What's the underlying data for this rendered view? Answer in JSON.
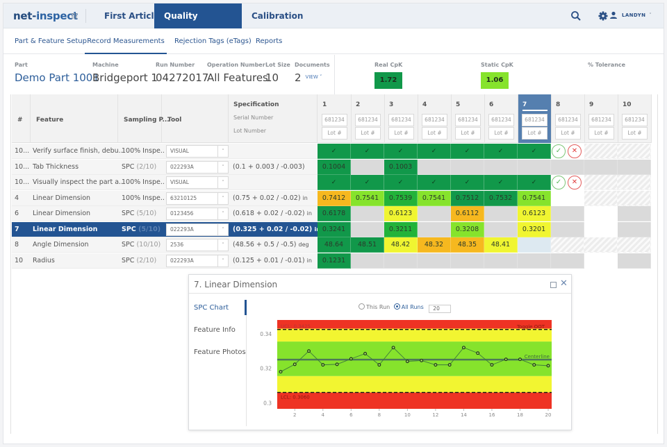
{
  "app": {
    "logo": {
      "part1": "net",
      "part2": "-",
      "part3": "inspect"
    },
    "top_nav": [
      {
        "label": "First Articles",
        "active": false
      },
      {
        "label": "Quality Management",
        "active": true
      },
      {
        "label": "Calibration",
        "active": false
      }
    ],
    "user": "LANDYN",
    "icons": [
      "search-icon",
      "gear-icon",
      "user-icon",
      "chevron-down-icon",
      "grid-icon"
    ]
  },
  "sub_nav": [
    {
      "label": "Part & Feature Setup",
      "active": false
    },
    {
      "label": "Record Measurements",
      "active": true
    },
    {
      "label": "Rejection Tags (eTags)",
      "active": false
    },
    {
      "label": "Reports",
      "active": false
    }
  ],
  "info": {
    "part": {
      "label": "Part",
      "value": "Demo Part 1001"
    },
    "machine": {
      "label": "Machine",
      "value": "Bridgeport 1"
    },
    "run_number": {
      "label": "Run Number",
      "value": "04272017"
    },
    "operation_number": {
      "label": "Operation Number",
      "value": "All Features"
    },
    "lot_size": {
      "label": "Lot Size",
      "value": "10"
    },
    "documents": {
      "label": "Documents",
      "value": "2",
      "link": "VIEW ˅"
    },
    "real_cpk": {
      "label": "Real CpK",
      "value": "1.72",
      "color": "#11984a"
    },
    "static_cpk": {
      "label": "Static CpK",
      "value": "1.06",
      "color": "#86e32c"
    },
    "tolerance": {
      "label": "% Tolerance",
      "value": ""
    }
  },
  "table": {
    "headers": {
      "num": "#",
      "feature": "Feature",
      "sampling": "Sampling P...",
      "tool": "Tool",
      "spec": "Specification",
      "serial": "Serial Number",
      "lot": "Lot Number"
    },
    "columns": [
      {
        "n": "1",
        "serial": "681234",
        "lot": "Lot #"
      },
      {
        "n": "2",
        "serial": "681234",
        "lot": "Lot #"
      },
      {
        "n": "3",
        "serial": "681234",
        "lot": "Lot #"
      },
      {
        "n": "4",
        "serial": "681234",
        "lot": "Lot #"
      },
      {
        "n": "5",
        "serial": "681234",
        "lot": "Lot #"
      },
      {
        "n": "6",
        "serial": "681234",
        "lot": "Lot #"
      },
      {
        "n": "7",
        "serial": "681234",
        "lot": "Lot #",
        "active": true
      },
      {
        "n": "8",
        "serial": "681234",
        "lot": "Lot #"
      },
      {
        "n": "9",
        "serial": "681234",
        "lot": "Lot #"
      },
      {
        "n": "10",
        "serial": "681234",
        "lot": "Lot #"
      }
    ],
    "rows": [
      {
        "num": "10...",
        "feature": "Verify surface finish, debu...",
        "sampling": "100% Inspe...",
        "sampling_sub": "",
        "tool": "VISUAL",
        "spec": "",
        "unit": "",
        "cells": [
          [
            "dg",
            "✓"
          ],
          [
            "dg",
            "✓"
          ],
          [
            "dg",
            "✓"
          ],
          [
            "dg",
            "✓"
          ],
          [
            "dg",
            "✓"
          ],
          [
            "dg",
            "✓"
          ],
          [
            "dg",
            "✓"
          ],
          [
            "passfail",
            ""
          ],
          [
            "hatch",
            ""
          ],
          [
            "hatch",
            ""
          ]
        ]
      },
      {
        "num": "10...",
        "feature": "Tab Thickness",
        "sampling": "SPC",
        "sampling_sub": "(2/10)",
        "tool": "022293A",
        "spec": "(0.1 + 0.003 / -0.003)",
        "unit": "",
        "cells": [
          [
            "dg",
            "0.1004"
          ],
          [
            "gr",
            ""
          ],
          [
            "dg",
            "0.1003"
          ],
          [
            "gr",
            ""
          ],
          [
            "gr",
            ""
          ],
          [
            "gr",
            ""
          ],
          [
            "gr",
            ""
          ],
          [
            "gr",
            ""
          ],
          [
            "gr",
            ""
          ],
          [
            "gr",
            ""
          ]
        ]
      },
      {
        "num": "10...",
        "feature": "Visually inspect the part a...",
        "sampling": "100% Inspe...",
        "sampling_sub": "",
        "tool": "VISUAL",
        "spec": "",
        "unit": "",
        "cells": [
          [
            "dg",
            "✓"
          ],
          [
            "dg",
            "✓"
          ],
          [
            "dg",
            "✓"
          ],
          [
            "dg",
            "✓"
          ],
          [
            "dg",
            "✓"
          ],
          [
            "dg",
            "✓"
          ],
          [
            "dg",
            "✓"
          ],
          [
            "passfail",
            ""
          ],
          [
            "hatch",
            ""
          ],
          [
            "hatch",
            ""
          ]
        ]
      },
      {
        "num": "4",
        "feature": "Linear Dimension",
        "sampling": "100% Inspe...",
        "sampling_sub": "",
        "tool": "63210125",
        "spec": "(0.75 + 0.02 / -0.02)",
        "unit": "in",
        "cells": [
          [
            "or",
            "0.7412"
          ],
          [
            "lg",
            "0.7541"
          ],
          [
            "mg",
            "0.7539"
          ],
          [
            "lg",
            "0.7541"
          ],
          [
            "dg",
            "0.7512"
          ],
          [
            "dg",
            "0.7532"
          ],
          [
            "lg",
            "0.7541"
          ],
          [
            "wh",
            ""
          ],
          [
            "hatch",
            ""
          ],
          [
            "hatch",
            ""
          ]
        ]
      },
      {
        "num": "6",
        "feature": "Linear Dimension",
        "sampling": "SPC",
        "sampling_sub": "(5/10)",
        "tool": "0123456",
        "spec": "(0.618 + 0.02 / -0.02)",
        "unit": "in",
        "cells": [
          [
            "dg",
            "0.6178"
          ],
          [
            "gr",
            ""
          ],
          [
            "yl",
            "0.6123"
          ],
          [
            "gr",
            ""
          ],
          [
            "or",
            "0.6112"
          ],
          [
            "gr",
            ""
          ],
          [
            "yl",
            "0.6123"
          ],
          [
            "gr",
            ""
          ],
          [
            "wh",
            ""
          ],
          [
            "gr",
            ""
          ]
        ]
      },
      {
        "num": "7",
        "feature": "Linear Dimension",
        "sampling": "SPC",
        "sampling_sub": "(5/10)",
        "tool": "022293A",
        "spec": "(0.325 + 0.02 / -0.02)",
        "unit": "in",
        "selected": true,
        "cells": [
          [
            "dg",
            "0.3241"
          ],
          [
            "gr",
            ""
          ],
          [
            "mg",
            "0.3211"
          ],
          [
            "gr",
            ""
          ],
          [
            "lg",
            "0.3208"
          ],
          [
            "gr",
            ""
          ],
          [
            "yl",
            "0.3201"
          ],
          [
            "gr",
            ""
          ],
          [
            "wh",
            ""
          ],
          [
            "gr",
            ""
          ]
        ]
      },
      {
        "num": "8",
        "feature": "Angle Dimension",
        "sampling": "SPC",
        "sampling_sub": "(10/10)",
        "tool": "2536",
        "spec": "(48.56 + 0.5 / -0.5)",
        "unit": "deg",
        "cells": [
          [
            "dg",
            "48.64"
          ],
          [
            "dg",
            "48.51"
          ],
          [
            "yl",
            "48.42"
          ],
          [
            "or",
            "48.32"
          ],
          [
            "or",
            "48.35"
          ],
          [
            "yl",
            "48.41"
          ],
          [
            "lb",
            ""
          ],
          [
            "hatch",
            ""
          ],
          [
            "hatch",
            ""
          ],
          [
            "hatch",
            ""
          ]
        ]
      },
      {
        "num": "10",
        "feature": "Radius",
        "sampling": "SPC",
        "sampling_sub": "(2/10)",
        "tool": "022293A",
        "spec": "(0.125 + 0.01 / -0.01)",
        "unit": "in",
        "cells": [
          [
            "dg",
            "0.1231"
          ],
          [
            "gr",
            ""
          ],
          [
            "gr",
            ""
          ],
          [
            "gr",
            ""
          ],
          [
            "gr",
            ""
          ],
          [
            "gr",
            ""
          ],
          [
            "gr",
            ""
          ],
          [
            "gr",
            ""
          ],
          [
            "wh",
            ""
          ],
          [
            "gr",
            ""
          ]
        ]
      }
    ],
    "pass_label": "✓",
    "fail_label": "✕"
  },
  "modal": {
    "title": "7. Linear Dimension",
    "side_tabs": [
      {
        "label": "SPC Chart",
        "active": true
      },
      {
        "label": "Feature Info",
        "active": false
      },
      {
        "label": "Feature Photos",
        "active": false
      }
    ],
    "radio_this_run": "This Run",
    "radio_all_runs": "All Runs",
    "selected_radio": "All Runs",
    "runs_count": "20"
  },
  "chart_data": {
    "type": "line",
    "title": "",
    "xlabel": "",
    "ylabel": "",
    "x": [
      1,
      2,
      3,
      4,
      5,
      6,
      7,
      8,
      9,
      10,
      11,
      12,
      13,
      14,
      15,
      16,
      17,
      18,
      19,
      20
    ],
    "series": [
      {
        "name": "Measurements",
        "values": [
          0.318,
          0.3223,
          0.33,
          0.322,
          0.3223,
          0.3255,
          0.3285,
          0.322,
          0.332,
          0.324,
          0.3245,
          0.322,
          0.322,
          0.332,
          0.3288,
          0.322,
          0.3252,
          0.3252,
          0.322,
          0.3215
        ]
      }
    ],
    "ucl": 0.3425,
    "lcl": 0.306,
    "centerline": 0.325,
    "ucl_label": "UCL: 0.3425",
    "lcl_label": "LCL: 0.3060",
    "centerline_label": "Centerline",
    "toggle_label": "Toggle OOT",
    "ylim": [
      0.2965,
      0.348
    ],
    "xlim": [
      1,
      20
    ],
    "xticks": [
      2,
      4,
      6,
      8,
      10,
      12,
      14,
      16,
      18,
      20
    ],
    "yticks": [
      0.3,
      0.32,
      0.34
    ],
    "ytick_labels": [
      "0.3",
      "0.32",
      "0.34"
    ],
    "zones": [
      {
        "from": 0.2965,
        "to": 0.306,
        "color": "#ee3324"
      },
      {
        "from": 0.306,
        "to": 0.3155,
        "color": "#f2f531"
      },
      {
        "from": 0.3155,
        "to": 0.3355,
        "color": "#86e32c"
      },
      {
        "from": 0.3355,
        "to": 0.343,
        "color": "#f2f531"
      },
      {
        "from": 0.343,
        "to": 0.348,
        "color": "#ee3324"
      }
    ],
    "grid": false,
    "legend": "none"
  }
}
